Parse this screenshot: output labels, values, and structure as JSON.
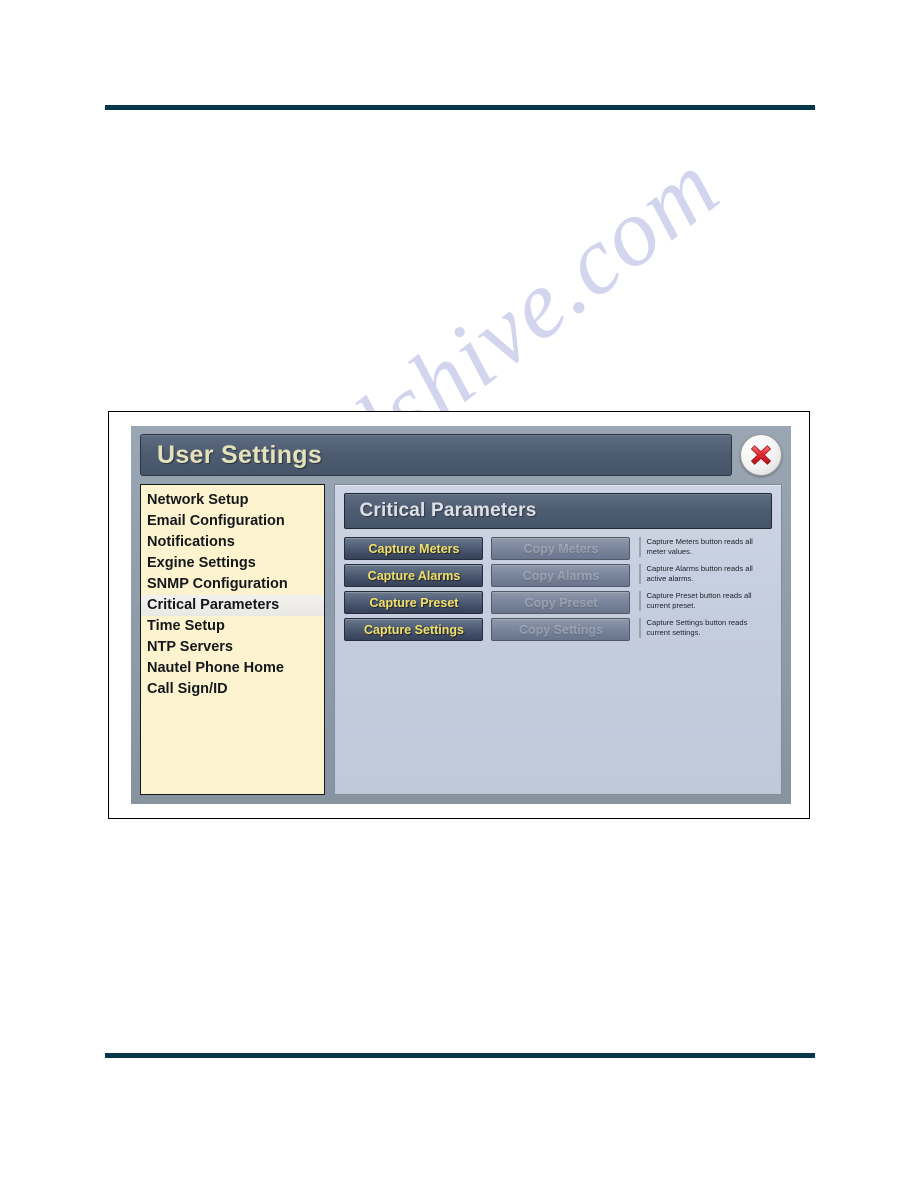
{
  "page": {
    "watermark_text": "manualshive.com"
  },
  "dialog": {
    "title": "User Settings",
    "close_icon": "close-x-icon",
    "sidebar": {
      "items": [
        {
          "label": "Network Setup",
          "selected": false
        },
        {
          "label": "Email Configuration",
          "selected": false
        },
        {
          "label": "Notifications",
          "selected": false
        },
        {
          "label": "Exgine Settings",
          "selected": false
        },
        {
          "label": "SNMP Configuration",
          "selected": false
        },
        {
          "label": "Critical Parameters",
          "selected": true
        },
        {
          "label": "Time Setup",
          "selected": false
        },
        {
          "label": "NTP Servers",
          "selected": false
        },
        {
          "label": "Nautel Phone Home",
          "selected": false
        },
        {
          "label": "Call Sign/ID",
          "selected": false
        }
      ]
    },
    "content": {
      "panel_title": "Critical Parameters",
      "rows": [
        {
          "capture_label": "Capture Meters",
          "copy_label": "Copy Meters",
          "copy_disabled": true,
          "description": "Capture Meters button reads all meter values."
        },
        {
          "capture_label": "Capture Alarms",
          "copy_label": "Copy Alarms",
          "copy_disabled": true,
          "description": "Capture Alarms button reads all active alarms."
        },
        {
          "capture_label": "Capture Preset",
          "copy_label": "Copy Preset",
          "copy_disabled": true,
          "description": "Capture Preset button reads all current preset."
        },
        {
          "capture_label": "Capture Settings",
          "copy_label": "Copy Settings",
          "copy_disabled": true,
          "description": "Capture Settings button reads current settings."
        }
      ]
    }
  },
  "colors": {
    "rule": "#05374a",
    "titlebar_text": "#e4e2bb",
    "capture_text": "#f2e06a",
    "sidebar_bg": "#fdf4cf",
    "content_bg": "#c4cdde",
    "chrome": "#8e9ba9",
    "close_x": "#e3292f"
  }
}
